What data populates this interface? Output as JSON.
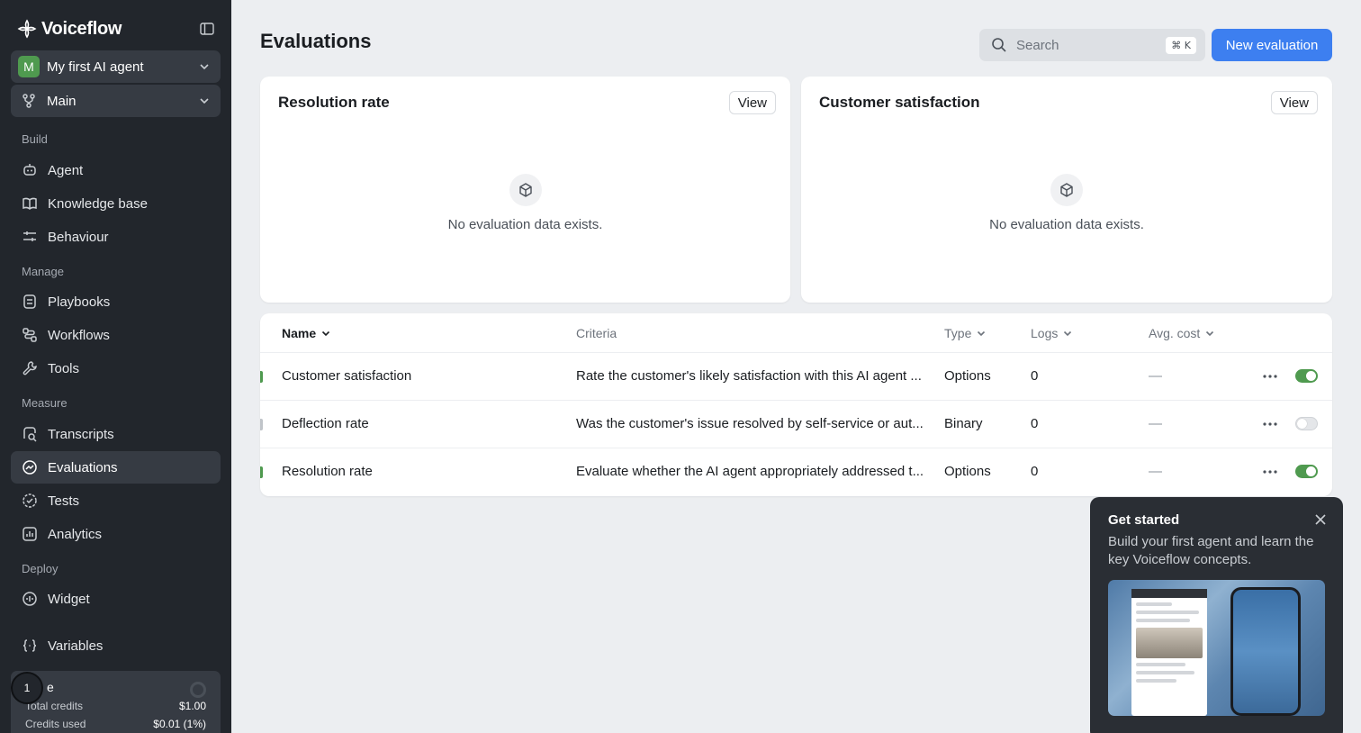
{
  "app": {
    "brand": "Voiceflow"
  },
  "sidebar": {
    "agent_selector": {
      "avatar_letter": "M",
      "label": "My first AI agent"
    },
    "branch_selector": {
      "label": "Main"
    },
    "sections": {
      "build": "Build",
      "manage": "Manage",
      "measure": "Measure",
      "deploy": "Deploy"
    },
    "items": {
      "agent": "Agent",
      "knowledge_base": "Knowledge base",
      "behaviour": "Behaviour",
      "playbooks": "Playbooks",
      "workflows": "Workflows",
      "tools": "Tools",
      "transcripts": "Transcripts",
      "evaluations": "Evaluations",
      "tests": "Tests",
      "analytics": "Analytics",
      "widget": "Widget",
      "variables": "Variables"
    },
    "active_item": "evaluations",
    "credits": {
      "badge": "1",
      "title_fragment": "e",
      "total_label": "Total credits",
      "total_value": "$1.00",
      "used_label": "Credits used",
      "used_value": "$0.01 (1%)"
    }
  },
  "header": {
    "title": "Evaluations",
    "search_placeholder": "Search",
    "search_shortcut": "⌘ K",
    "new_button": "New evaluation"
  },
  "cards": [
    {
      "title": "Resolution rate",
      "view_label": "View",
      "empty_text": "No evaluation data exists."
    },
    {
      "title": "Customer satisfaction",
      "view_label": "View",
      "empty_text": "No evaluation data exists."
    }
  ],
  "table": {
    "columns": {
      "name": "Name",
      "criteria": "Criteria",
      "type": "Type",
      "logs": "Logs",
      "avg_cost": "Avg. cost"
    },
    "rows": [
      {
        "name": "Customer satisfaction",
        "criteria": "Rate the customer's likely satisfaction with this AI agent ...",
        "type": "Options",
        "logs": "0",
        "avg_cost": "—",
        "enabled": true
      },
      {
        "name": "Deflection rate",
        "criteria": "Was the customer's issue resolved by self-service or aut...",
        "type": "Binary",
        "logs": "0",
        "avg_cost": "—",
        "enabled": false
      },
      {
        "name": "Resolution rate",
        "criteria": "Evaluate whether the AI agent appropriately addressed t...",
        "type": "Options",
        "logs": "0",
        "avg_cost": "—",
        "enabled": true
      }
    ]
  },
  "get_started": {
    "title": "Get started",
    "description": "Build your first agent and learn the key Voiceflow concepts."
  },
  "colors": {
    "sidebar_bg": "#22262c",
    "accent_blue": "#3d7ff0",
    "toggle_on": "#4f9a4f",
    "page_bg": "#eceef1"
  }
}
